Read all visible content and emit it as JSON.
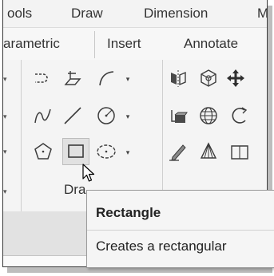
{
  "menu": {
    "items": [
      {
        "key": "tools",
        "label": "ools"
      },
      {
        "key": "draw",
        "label": "Draw"
      },
      {
        "key": "dimension",
        "label": "Dimension"
      },
      {
        "key": "more",
        "label": "M"
      }
    ]
  },
  "ribbon_tabs": {
    "items": [
      {
        "key": "parametric",
        "label": "arametric"
      },
      {
        "key": "insert",
        "label": "Insert"
      },
      {
        "key": "annotate",
        "label": "Annotate"
      }
    ]
  },
  "draw_panel": {
    "label": "Dra",
    "tools": [
      {
        "key": "polyline",
        "icon": "polyline-icon"
      },
      {
        "key": "region",
        "icon": "region-icon"
      },
      {
        "key": "arc",
        "icon": "arc-icon"
      },
      {
        "key": "spline",
        "icon": "spline-icon"
      },
      {
        "key": "line",
        "icon": "line-icon"
      },
      {
        "key": "circle",
        "icon": "circle-icon"
      },
      {
        "key": "polygon",
        "icon": "polygon-icon"
      },
      {
        "key": "rectangle",
        "icon": "rectangle-icon"
      },
      {
        "key": "ellipse",
        "icon": "ellipse-icon"
      }
    ]
  },
  "modeling_panel": {
    "tools": [
      {
        "key": "mirror",
        "icon": "mirror-icon"
      },
      {
        "key": "intersect",
        "icon": "intersect-icon"
      },
      {
        "key": "move",
        "icon": "move-icon"
      },
      {
        "key": "extrude",
        "icon": "extrude-icon"
      },
      {
        "key": "sphere",
        "icon": "sphere-icon"
      },
      {
        "key": "rotate",
        "icon": "rotate-icon"
      },
      {
        "key": "pencil",
        "icon": "pencil-icon"
      },
      {
        "key": "cone",
        "icon": "cone-icon"
      },
      {
        "key": "box",
        "icon": "box-icon"
      }
    ]
  },
  "tooltip": {
    "title": "Rectangle",
    "description": "Creates a rectangular"
  },
  "colors": {
    "frame_bg": "#f0f0f0",
    "hover_bg": "#e1e1e1",
    "icon_stroke": "#3c3c3c"
  }
}
